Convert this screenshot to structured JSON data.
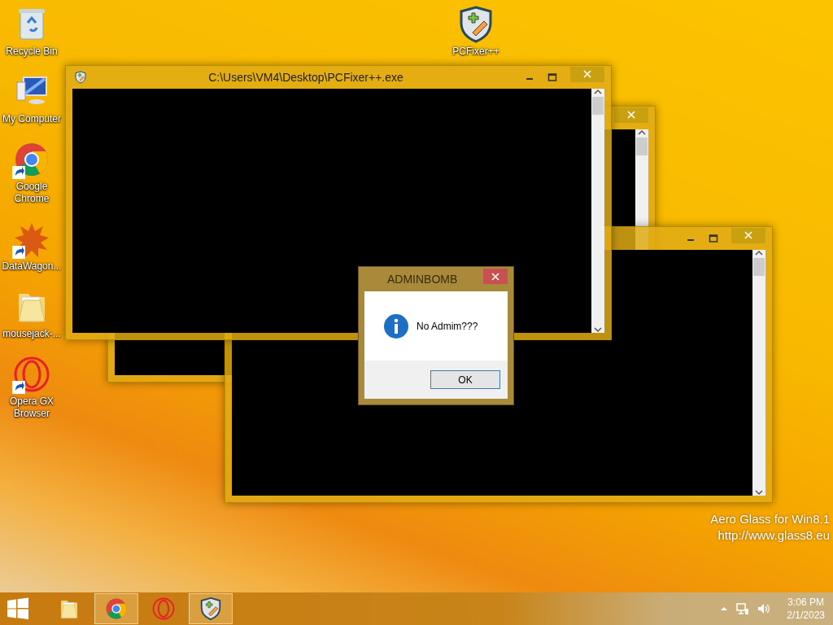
{
  "desktop_icons": [
    {
      "kind": "recycle-bin",
      "label": "Recycle Bin",
      "shortcut": false
    },
    {
      "kind": "computer",
      "label": "My Computer",
      "shortcut": false
    },
    {
      "kind": "chrome",
      "label": "Google Chrome",
      "shortcut": true
    },
    {
      "kind": "splat",
      "label": "DataWagon...",
      "shortcut": true
    },
    {
      "kind": "folder",
      "label": "mousejack-...",
      "shortcut": false
    },
    {
      "kind": "opera",
      "label": "Opera GX Browser",
      "shortcut": true
    },
    {
      "kind": "shield",
      "label": "PCFixer++",
      "shortcut": false
    }
  ],
  "windows": [
    {
      "kind": "console"
    },
    {
      "kind": "console"
    },
    {
      "kind": "console",
      "title": "C:\\Users\\VM4\\Desktop\\PCFixer++.exe"
    }
  ],
  "dialog": {
    "title": "ADMINBOMB",
    "message": "No Admim???",
    "button": "OK"
  },
  "watermark": [
    "Aero Glass for Win8.1",
    "http://www.glass8.eu"
  ],
  "taskbar": {
    "items": [
      {
        "kind": "folder",
        "running": false
      },
      {
        "kind": "chrome",
        "running": true
      },
      {
        "kind": "opera",
        "running": false
      },
      {
        "kind": "shield",
        "running": true
      }
    ],
    "time": "3:06 PM",
    "date": "2/1/2023"
  }
}
